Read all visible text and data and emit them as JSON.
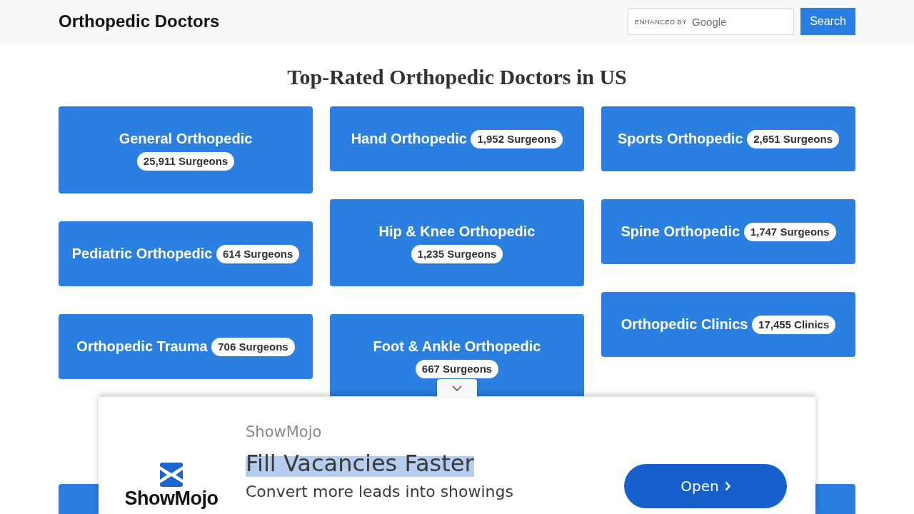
{
  "header": {
    "title": "Orthopedic Doctors",
    "search": {
      "branding_label": "ENHANCED BY",
      "branding_logo": "Google"
    },
    "search_button": "Search"
  },
  "heading": "Top-Rated Orthopedic Doctors in US",
  "categories": [
    {
      "name": "General Orthopedic",
      "count": "25,911 Surgeons"
    },
    {
      "name": "Hand Orthopedic",
      "count": "1,952 Surgeons"
    },
    {
      "name": "Sports Orthopedic",
      "count": "2,651 Surgeons"
    },
    {
      "name": "Pediatric Orthopedic",
      "count": "614 Surgeons"
    },
    {
      "name": "Hip & Knee Orthopedic",
      "count": "1,235 Surgeons"
    },
    {
      "name": "Spine Orthopedic",
      "count": "1,747 Surgeons"
    },
    {
      "name": "Orthopedic Trauma",
      "count": "706 Surgeons"
    },
    {
      "name": "Foot & Ankle Orthopedic",
      "count": "667 Surgeons"
    },
    {
      "name": "Orthopedic Clinics",
      "count": "17,455 Clinics"
    }
  ],
  "lower_cards": [
    {
      "kind": "card"
    },
    {
      "kind": "card"
    }
  ],
  "ad": {
    "logo_wordmark": "ShowMojo",
    "advertiser": "ShowMojo",
    "headline": {
      "text": "Fill Vacancies Faster",
      "highlighted": true
    },
    "description": "Convert more leads into showings",
    "button": "Open"
  }
}
